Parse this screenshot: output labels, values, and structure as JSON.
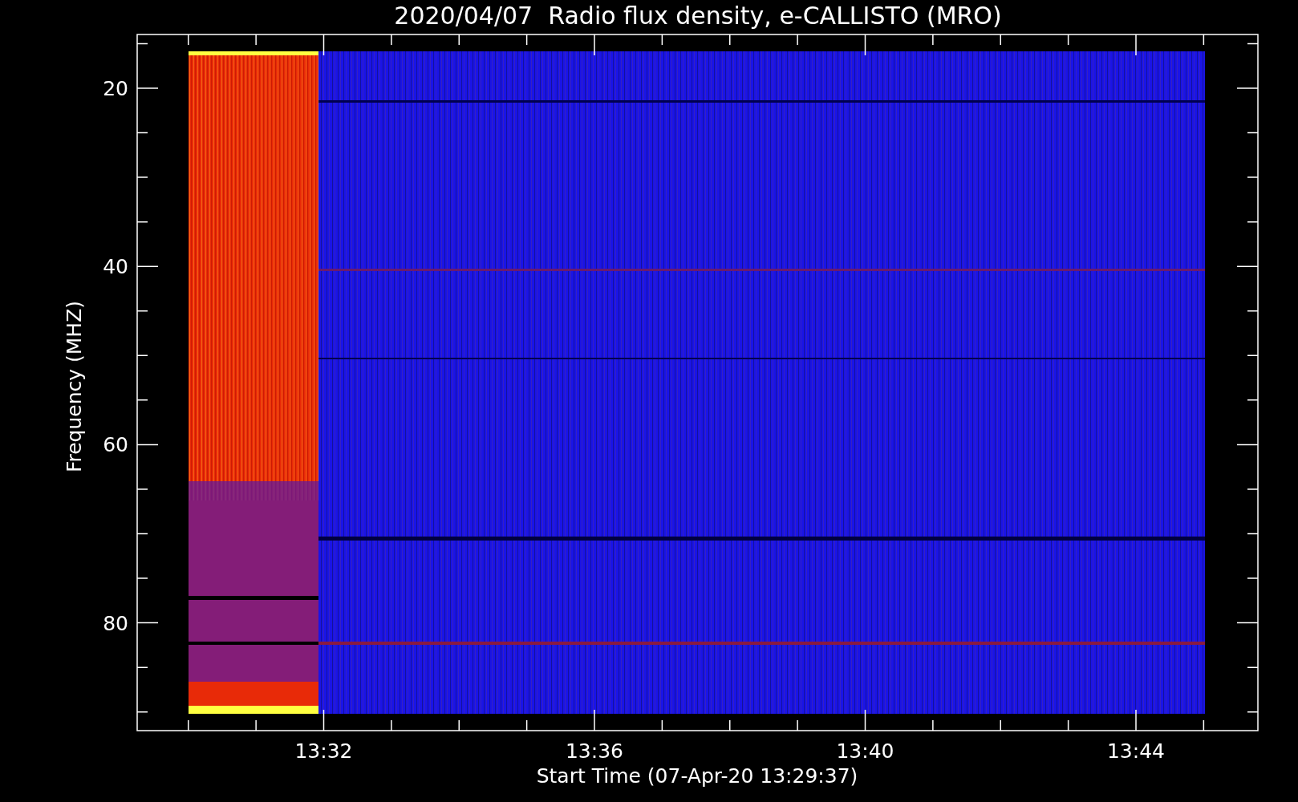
{
  "title": "2020/04/07  Radio flux density, e-CALLISTO (MRO)",
  "y_axis": {
    "label": "Frequency (MHZ)",
    "ticks": [
      "20",
      "40",
      "60",
      "80"
    ]
  },
  "x_axis": {
    "label": "Start Time (07-Apr-20 13:29:37)",
    "ticks": [
      "13:32",
      "13:36",
      "13:40",
      "13:44"
    ]
  }
}
